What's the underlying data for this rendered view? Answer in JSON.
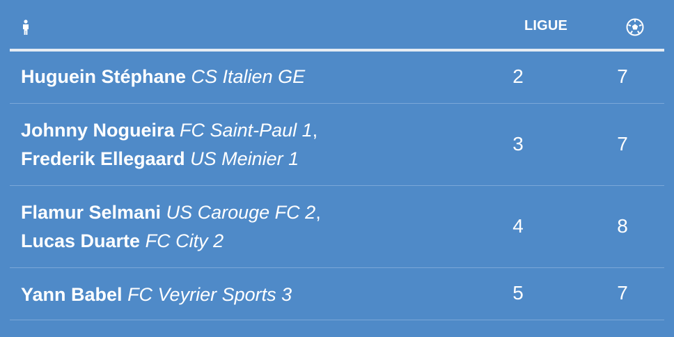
{
  "header": {
    "player_icon": "player-icon",
    "ligue_label": "LIGUE",
    "goals_icon": "soccer-ball-icon"
  },
  "colors": {
    "background": "#4f8ac8",
    "header_rule": "#e4ebf3",
    "row_divider": "#7ba7d8",
    "text": "#ffffff"
  },
  "rows": [
    {
      "players": [
        {
          "name": "Huguein Stéphane",
          "club": "CS Italien GE",
          "suffix": ""
        }
      ],
      "ligue": "2",
      "buts": "7"
    },
    {
      "players": [
        {
          "name": "Johnny Nogueira",
          "club": "FC Saint-Paul 1",
          "suffix": ","
        },
        {
          "name": "Frederik Ellegaard",
          "club": "US Meinier 1",
          "suffix": ""
        }
      ],
      "ligue": "3",
      "buts": "7"
    },
    {
      "players": [
        {
          "name": "Flamur Selmani",
          "club": "US Carouge FC 2",
          "suffix": ","
        },
        {
          "name": "Lucas Duarte",
          "club": "FC City 2",
          "suffix": ""
        }
      ],
      "ligue": "4",
      "buts": "8"
    },
    {
      "players": [
        {
          "name": "Yann Babel",
          "club": "FC Veyrier Sports 3",
          "suffix": ""
        }
      ],
      "ligue": "5",
      "buts": "7"
    }
  ]
}
